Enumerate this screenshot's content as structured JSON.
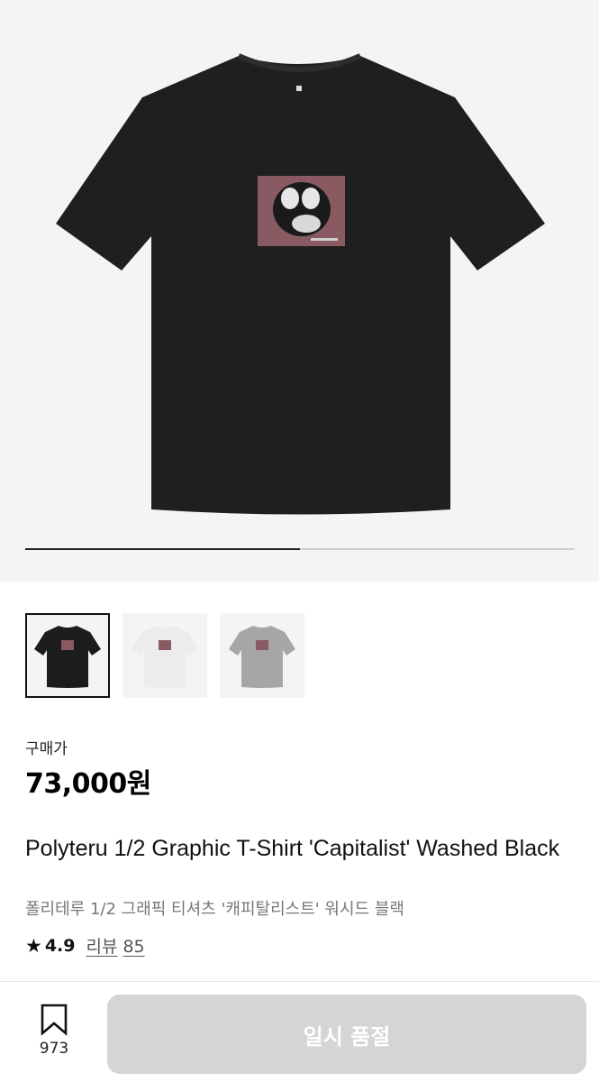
{
  "gallery": {
    "main_image_alt": "Polyteru 1/2 Graphic T-Shirt Capitalist Washed Black",
    "slide_progress": 0.5,
    "thumbnails": [
      {
        "color_name": "black",
        "shirt_color": "#1c1c1c",
        "selected": true
      },
      {
        "color_name": "white",
        "shirt_color": "#ececec",
        "selected": false
      },
      {
        "color_name": "grey",
        "shirt_color": "#a6a6a6",
        "selected": false
      }
    ]
  },
  "price": {
    "label": "구매가",
    "value": "73,000원"
  },
  "product": {
    "title": "Polyteru 1/2 Graphic T-Shirt 'Capitalist' Washed Black",
    "subtitle_ko": "폴리테루 1/2 그래픽 티셔츠 '캐피탈리스트' 워시드 블랙"
  },
  "rating": {
    "icon": "star-icon",
    "score": "4.9",
    "reviews_label": "리뷰",
    "reviews_count": "85"
  },
  "bottom_bar": {
    "bookmark_icon": "bookmark-icon",
    "bookmark_count": "973",
    "button_label": "일시 품절"
  },
  "colors": {
    "accent": "#111111",
    "disabled_button": "#d5d5d5",
    "muted_text": "#777777"
  }
}
